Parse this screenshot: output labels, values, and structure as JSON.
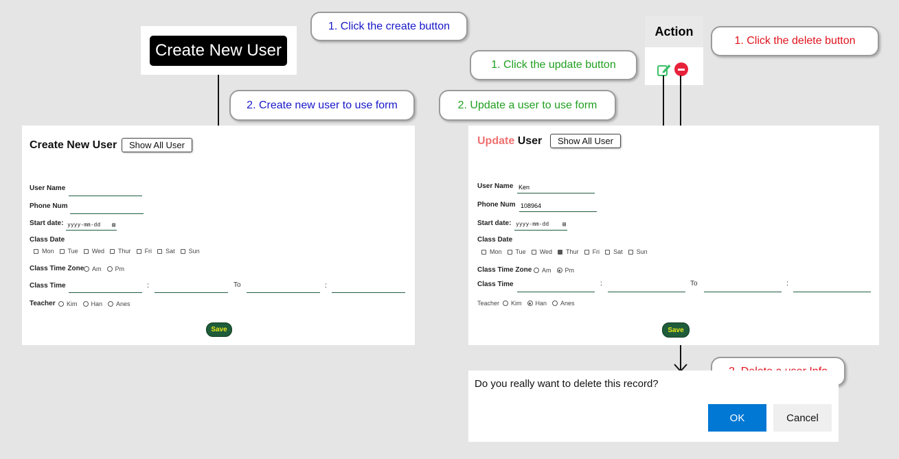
{
  "callouts": {
    "click_create": "1. Click the create button",
    "create_form": "2. Create new user to use form",
    "click_update": "1. Click the update button",
    "update_form": "2. Update a user to use form",
    "click_delete": "1. Click the delete button",
    "delete_info": "2. Delete a user Info"
  },
  "create_button": {
    "label": "Create New User"
  },
  "action_panel": {
    "header": "Action",
    "edit_icon": "edit-icon",
    "delete_icon": "minus-circle-icon"
  },
  "create_form": {
    "title": "Create New User",
    "show_all_label": "Show All User",
    "user_name_label": "User Name",
    "user_name_value": "",
    "phone_label": "Phone Num",
    "phone_value": "",
    "start_date_label": "Start date:",
    "start_date_placeholder": "yyyy-mm-dd",
    "class_date_label": "Class Date",
    "days": [
      {
        "label": "Mon",
        "checked": false
      },
      {
        "label": "Tue",
        "checked": false
      },
      {
        "label": "Wed",
        "checked": false
      },
      {
        "label": "Thur",
        "checked": false
      },
      {
        "label": "Fri",
        "checked": false
      },
      {
        "label": "Sat",
        "checked": false
      },
      {
        "label": "Sun",
        "checked": false
      }
    ],
    "time_zone_label": "Class Time Zone",
    "time_zones": [
      {
        "label": "Am",
        "checked": false
      },
      {
        "label": "Pm",
        "checked": false
      }
    ],
    "class_time_label": "Class Time",
    "colon": ":",
    "to_label": "To",
    "teacher_label": "Teacher",
    "teachers": [
      {
        "label": "Kim",
        "checked": false
      },
      {
        "label": "Han",
        "checked": false
      },
      {
        "label": "Anes",
        "checked": false
      }
    ],
    "save_label": "Save"
  },
  "update_form": {
    "title_update": "Update",
    "title_user": "User",
    "title_color": "#f07070",
    "show_all_label": "Show All User",
    "user_name_label": "User Name",
    "user_name_value": "Ken",
    "phone_label": "Phone Num",
    "phone_value": "108964",
    "start_date_label": "Start date:",
    "start_date_placeholder": "yyyy-mm-dd",
    "class_date_label": "Class Date",
    "days": [
      {
        "label": "Mon",
        "checked": false
      },
      {
        "label": "Tue",
        "checked": false
      },
      {
        "label": "Wed",
        "checked": false
      },
      {
        "label": "Thur",
        "checked": true
      },
      {
        "label": "Fri",
        "checked": false
      },
      {
        "label": "Sat",
        "checked": false
      },
      {
        "label": "Sun",
        "checked": false
      }
    ],
    "time_zone_label": "Class Time Zone",
    "time_zones": [
      {
        "label": "Am",
        "checked": false
      },
      {
        "label": "Pm",
        "checked": true
      }
    ],
    "class_time_label": "Class Time",
    "colon": ":",
    "to_label": "To",
    "teacher_label": "Teacher",
    "teachers": [
      {
        "label": "Kim",
        "checked": false
      },
      {
        "label": "Han",
        "checked": true
      },
      {
        "label": "Anes",
        "checked": false
      }
    ],
    "save_label": "Save"
  },
  "delete_dialog": {
    "message": "Do you really want to delete this record?",
    "ok_label": "OK",
    "cancel_label": "Cancel",
    "ok_color": "#0078d4"
  }
}
